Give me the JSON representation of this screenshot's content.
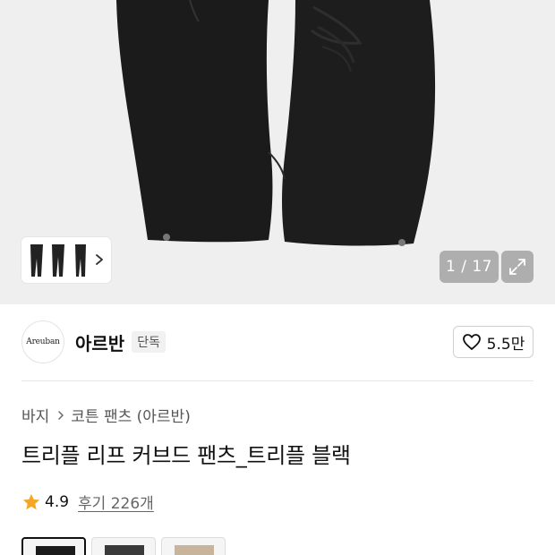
{
  "gallery": {
    "counter": "1 / 17",
    "thumbnail_icon": "pants-thumbnail",
    "next_icon": "chevron-right-icon",
    "expand_icon": "expand-icon"
  },
  "brand": {
    "logo_text": "Areuban",
    "name": "아르반",
    "badge": "단독",
    "likes": "5.5만",
    "like_icon": "heart-icon"
  },
  "breadcrumb": {
    "items": [
      "바지",
      "코튼 팬츠 (아르반)"
    ],
    "separator_icon": "chevron-right-icon"
  },
  "product": {
    "title": "트리플 리프 커브드 팬츠_트리플 블랙",
    "rating": "4.9",
    "reviews": "후기 226개",
    "star_color": "#f5a623"
  },
  "colors": {
    "hero_background": "#efefef",
    "pants": "#1b1b1b",
    "swatch_beige": "#c8b49a"
  }
}
